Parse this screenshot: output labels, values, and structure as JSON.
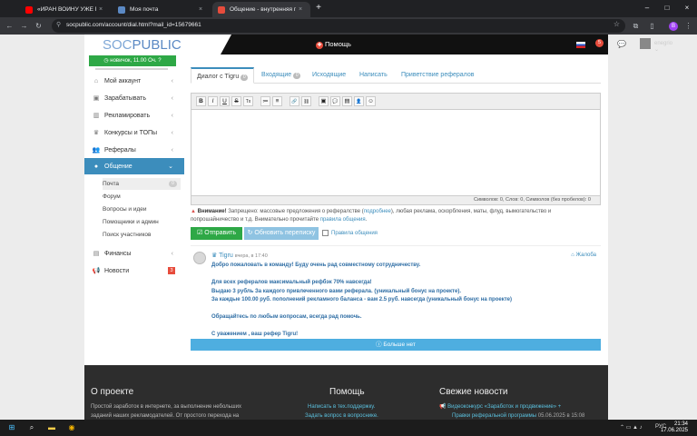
{
  "browser": {
    "tabs": [
      {
        "title": "«ИРАН ВОЙНУ УЖЕ ПРОИГРАЛ»...",
        "favicon_color": "#ff0000"
      },
      {
        "title": "Моя почта",
        "favicon_color": "#5b89c4"
      },
      {
        "title": "Общение - внутренняя почта",
        "favicon_color": "#e74c3c"
      }
    ],
    "url": "socpublic.com/account/dial.html?mail_id=15679661",
    "profile_initial": "B"
  },
  "header": {
    "logo_soc": "SOC",
    "logo_public": "PUBLIC",
    "help": "Помощь",
    "notif_count": "5",
    "username": "enegrio"
  },
  "sidebar": {
    "status": "новичок, 11.00 Оч.",
    "items": [
      {
        "label": "Мой аккаунт",
        "icon": "home-icon"
      },
      {
        "label": "Зарабатывать",
        "icon": "money-icon"
      },
      {
        "label": "Рекламировать",
        "icon": "chart-icon"
      },
      {
        "label": "Конкурсы и ТОПы",
        "icon": "trophy-icon"
      },
      {
        "label": "Рефералы",
        "icon": "users-icon"
      },
      {
        "label": "Общение",
        "icon": "chat-icon"
      }
    ],
    "subitems": [
      {
        "label": "Почта",
        "count": "0"
      },
      {
        "label": "Форум"
      },
      {
        "label": "Вопросы и идеи"
      },
      {
        "label": "Помощники и админ"
      },
      {
        "label": "Поиск участников"
      }
    ],
    "finance": "Финансы",
    "news": "Новости",
    "news_count": "3"
  },
  "tabs": {
    "dialog": "Диалог с Tigru",
    "dialog_count": "0",
    "inbox": "Входящие",
    "inbox_count": "0",
    "outbox": "Исходящие",
    "write": "Написать",
    "welcome": "Приветствие рефералов"
  },
  "editor": {
    "buttons": [
      "B",
      "I",
      "U",
      "S",
      "Tx",
      "≔",
      "≡",
      "🔗",
      "⛓",
      "▣",
      "💬",
      "▤",
      "👤",
      "☺"
    ],
    "counter": "Символов: 0, Слов: 0, Символов (без пробелов): 0"
  },
  "warning": {
    "label": "Внимание!",
    "text1": "Запрещено: массовые предложения о рефералстве (",
    "link1": "подробнее",
    "text2": "), любая реклама, оскорбления, маты, флуд, вымогательство и попрошайничество и т.д. Внимательно прочитайте ",
    "link2": "правила общения",
    "text3": "."
  },
  "actions": {
    "send": "Отправить",
    "refresh": "Обновить переписку",
    "rules": "Правила общения"
  },
  "message": {
    "author": "Tigru",
    "time": "вчера, в 17:40",
    "complain": "Жалоба",
    "lines": [
      "Добро пожаловать в команду! Буду очень рад совместному сотрудничеству.",
      "",
      "Для всех рефералов максимальный рефбэк 70% навсегда!",
      "Выдаю 3 рубль За каждого привлеченного вами реферала. (уникальный бонус на проекте).",
      "За каждые 100.00 руб. пополнений рекламного баланса - вам 2.5 руб. навсегда (уникальный бонус на проекте)",
      "",
      "Обращайтесь по любым вопросам, всегда рад помочь.",
      "",
      "С уважением , ваш рефер Tigru!"
    ]
  },
  "more": "Больше нет",
  "footer": {
    "about_title": "О проекте",
    "about_text1": "Простой заработок в интернете, за выполнение небольших",
    "about_text2": "заданий наших рекламодателей. От простого перехода на",
    "help_title": "Помощь",
    "help_link1": "Написать в тех.поддержку.",
    "help_link2": "Задать вопрос в вопроснике.",
    "news_title": "Свежие новости",
    "news_link1": "Видеоконкурс «Заработок и продвижение» +",
    "news_link2": "Правки реферальной программы",
    "news_date": "05.06.2025 в 15:08"
  },
  "taskbar": {
    "lang": "РУС",
    "time": "21:34",
    "date": "17.06.2025"
  }
}
